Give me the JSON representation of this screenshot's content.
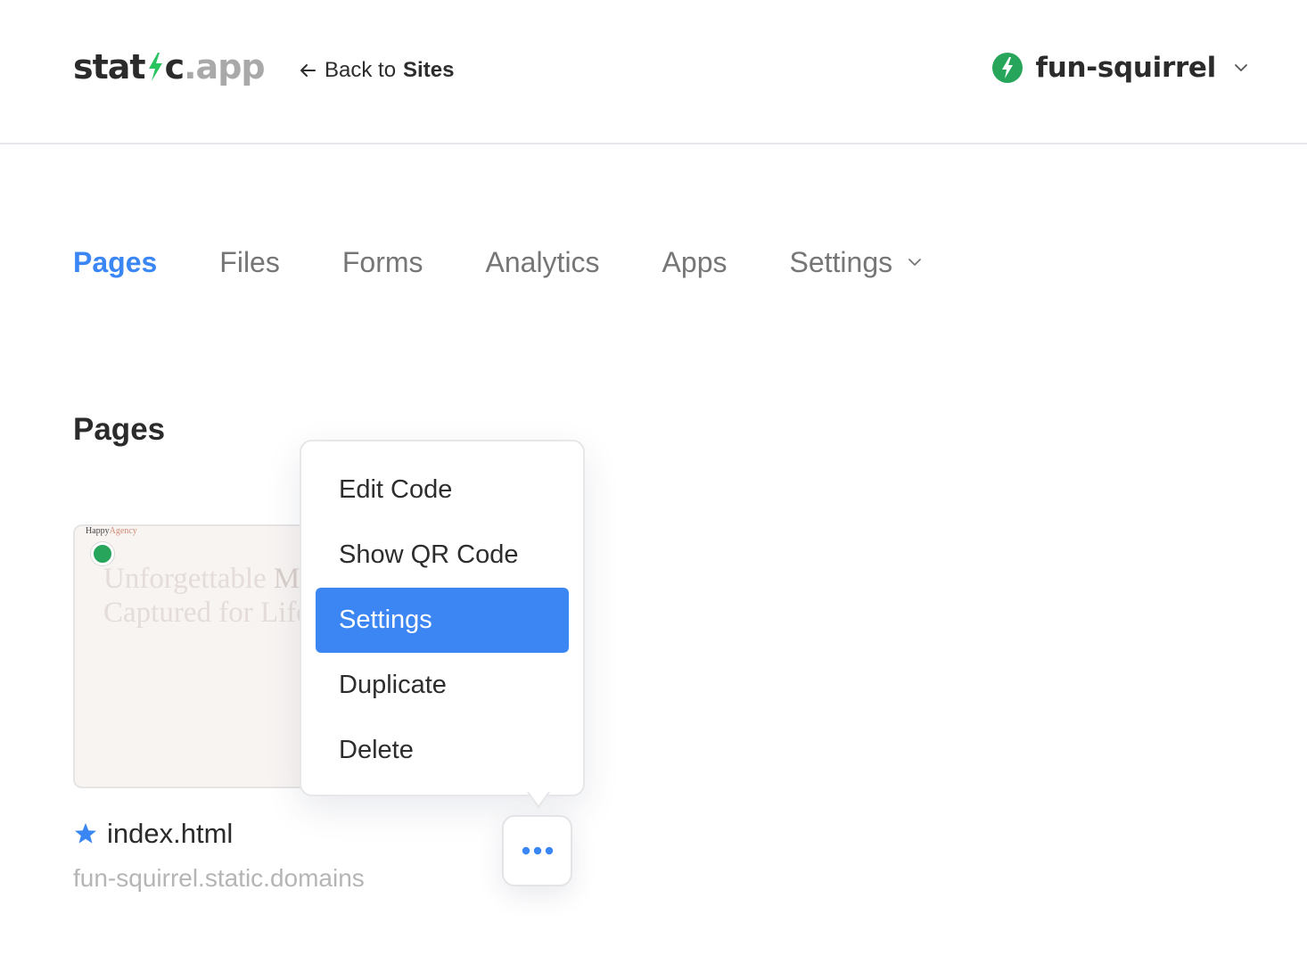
{
  "header": {
    "logo": {
      "part1": "stat",
      "part2": "c",
      "part3": ".app"
    },
    "back_link": {
      "prefix": "Back to",
      "target": "Sites"
    },
    "site": {
      "name": "fun-squirrel"
    }
  },
  "tabs": [
    {
      "label": "Pages",
      "active": true
    },
    {
      "label": "Files"
    },
    {
      "label": "Forms"
    },
    {
      "label": "Analytics"
    },
    {
      "label": "Apps"
    },
    {
      "label": "Settings",
      "has_dropdown": true
    }
  ],
  "section": {
    "title": "Pages"
  },
  "page_card": {
    "preview": {
      "brand_prefix": "Happy",
      "brand_accent": "Agency",
      "hero_line1_light": "Unforgettable ",
      "hero_line1_dark": "Mo",
      "hero_line2": "Captured for Life"
    },
    "file_name": "index.html",
    "domain": "fun-squirrel.static.domains",
    "status": "live"
  },
  "menu": {
    "items": [
      {
        "label": "Edit Code"
      },
      {
        "label": "Show QR Code"
      },
      {
        "label": "Settings",
        "highlighted": true
      },
      {
        "label": "Duplicate"
      },
      {
        "label": "Delete"
      }
    ]
  },
  "icons": {
    "logo_bolt": "lightning-bolt-icon",
    "back": "arrow-left-icon",
    "site_status": "bolt-circle-icon",
    "dropdown": "chevron-down-icon",
    "favorite": "star-icon",
    "more": "ellipsis-icon"
  },
  "colors": {
    "accent": "#3b86f5",
    "brand_green": "#27a55a",
    "text_dark": "#2b2b2b",
    "text_muted": "#767676"
  }
}
